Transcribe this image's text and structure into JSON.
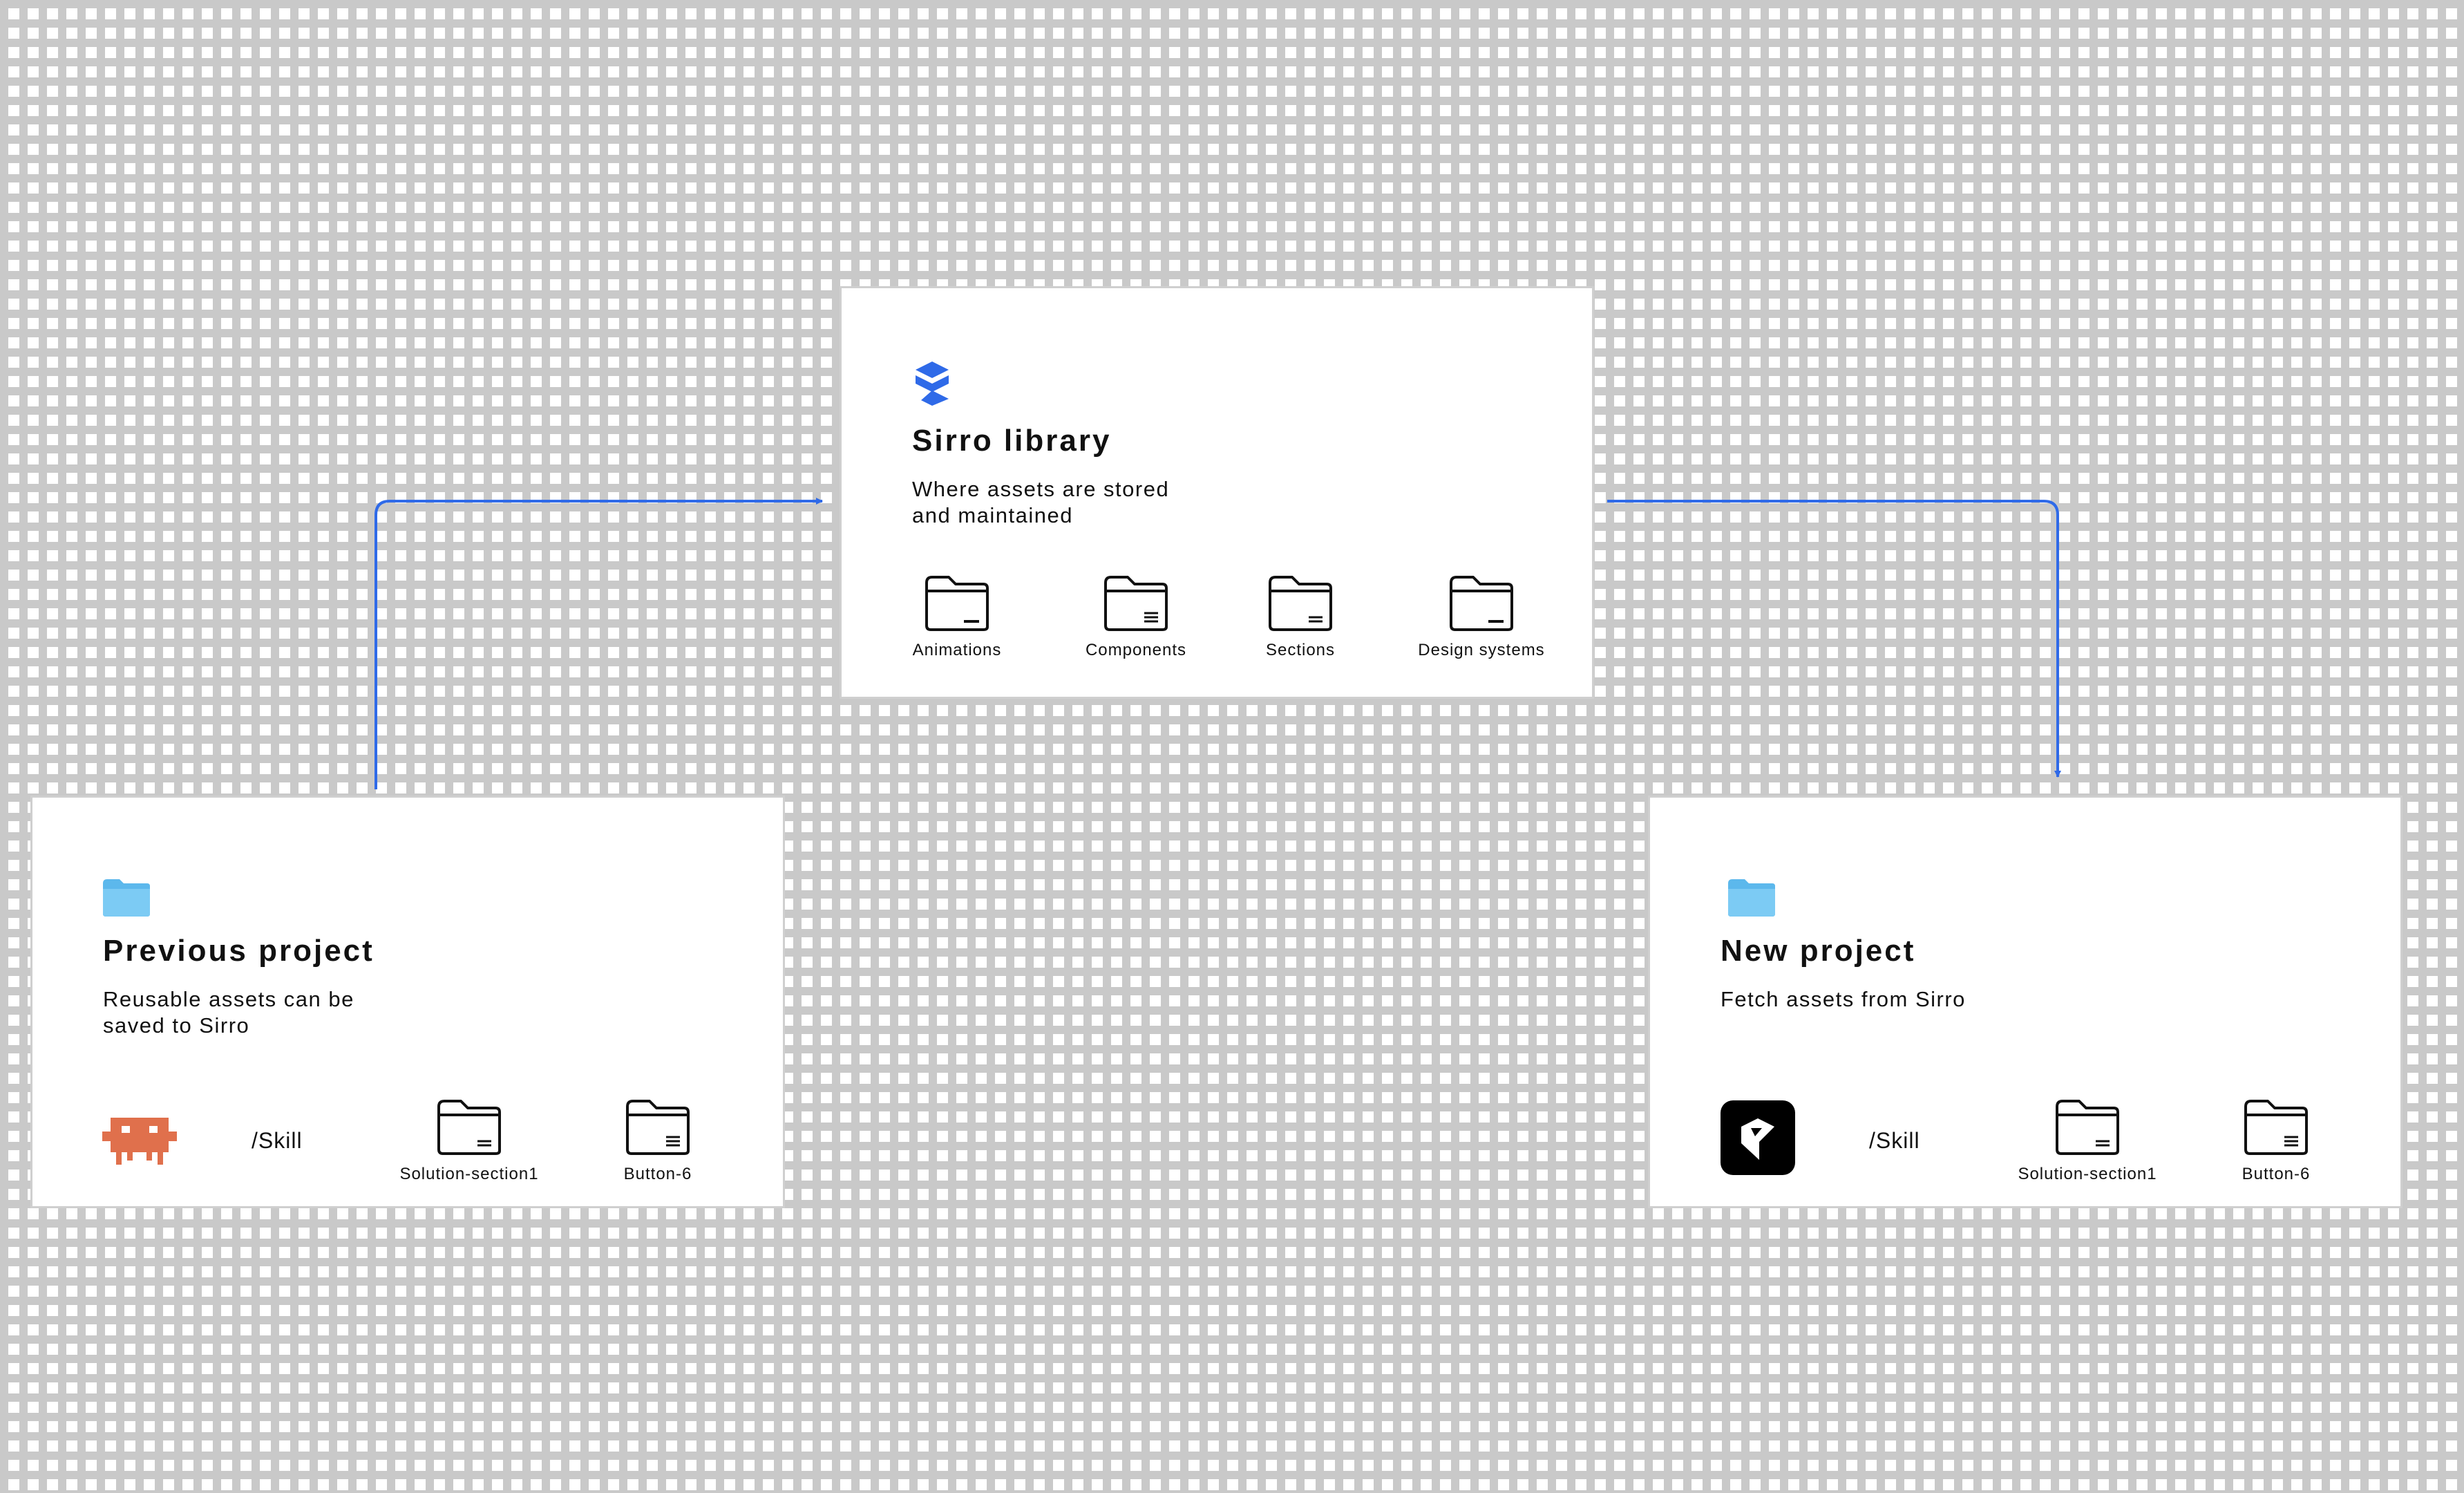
{
  "colors": {
    "accent": "#2F6AE8",
    "folder_light": "#6FC3F0",
    "skill_logo": "#E0704C",
    "card_border": "#cfcfcf"
  },
  "library": {
    "title": "Sirro library",
    "desc_lines": [
      "Where assets are stored",
      "and maintained"
    ],
    "icon": "sirro-logo-icon",
    "folders": [
      {
        "label": "Animations",
        "icon": "folder-icon"
      },
      {
        "label": "Components",
        "icon": "folder-list-icon"
      },
      {
        "label": "Sections",
        "icon": "folder-list-icon"
      },
      {
        "label": "Design systems",
        "icon": "folder-icon"
      }
    ]
  },
  "previous": {
    "title": "Previous project",
    "desc_lines": [
      "Reusable assets can be",
      "saved to Sirro"
    ],
    "icon": "folder-icon",
    "app_icon": "skill-pixel-logo-icon",
    "path": "/Skill",
    "files": [
      {
        "label": "Solution-section1",
        "icon": "folder-icon"
      },
      {
        "label": "Button-6",
        "icon": "folder-list-icon"
      }
    ]
  },
  "next": {
    "title": "New project",
    "desc_lines": [
      "Fetch assets from Sirro"
    ],
    "icon": "folder-icon",
    "app_icon": "framer-logo-icon",
    "path": "/Skill",
    "files": [
      {
        "label": "Solution-section1",
        "icon": "folder-icon"
      },
      {
        "label": "Button-6",
        "icon": "folder-list-icon"
      }
    ]
  }
}
